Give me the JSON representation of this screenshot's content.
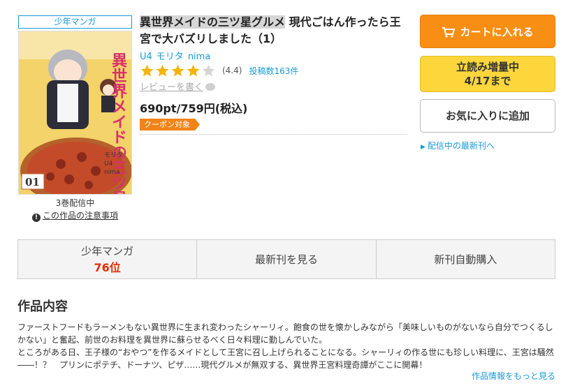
{
  "genre_tag": "少年マンガ",
  "cover": {
    "title_vertical": "異世界メイドの三ツ星グルメ",
    "author_label": "モリタ",
    "artist_label": "U4",
    "artist2_label": "nima",
    "volume_mark": "01"
  },
  "volume_count": "3巻配信中",
  "caution_link": "この作品の注意事項",
  "title_highlight": "異世界メイドの三ツ星グルメ",
  "title_rest": " 現代ごはん作ったら王宮で大バズリしました（1）",
  "authors": [
    "U4",
    "モリタ",
    "nima"
  ],
  "rating": {
    "stars_filled": 4,
    "stars_total": 5,
    "value_text": "(4.4)",
    "reviews_text": "投稿数163件"
  },
  "write_review": "レビューを書く",
  "price": "690pt/759円(税込)",
  "coupon": "クーポン対象",
  "buttons": {
    "cart": "カートに入れる",
    "trial_line1": "立読み増量中",
    "trial_line2": "4/17まで",
    "favorite": "お気に入りに追加"
  },
  "latest_link": "配信中の最新刊へ",
  "tabs": {
    "ranking_label": "少年マンガ",
    "ranking_value": "76位",
    "latest": "最新刊を見る",
    "auto_purchase": "新刊自動購入"
  },
  "section_title": "作品内容",
  "synopsis_p1": "ファーストフードもラーメンもない異世界に生まれ変わったシャーリィ。飽食の世を懐かしみながら「美味しいものがないなら自分でつくるしかない」と奮起、前世のお料理を異世界に蘇らせるべく日々料理に勤しんでいた。",
  "synopsis_p2": "ところがある日、王子様の“おやつ”を作るメイドとして王宮に召し上げられることになる。シャーリィの作る世にも珍しい料理に、王宮は騒然――！？　プリンにポテチ、ドーナツ、ピザ……現代グルメが無双する、異世界王宮料理奇譚がここに開幕！",
  "more_link": "作品情報をもっと見る",
  "colors": {
    "accent_blue": "#1a9ad6",
    "cart_orange": "#f98e14",
    "trial_yellow": "#fcd63a",
    "rank_red": "#e62d05",
    "star_gold": "#f5b301"
  }
}
